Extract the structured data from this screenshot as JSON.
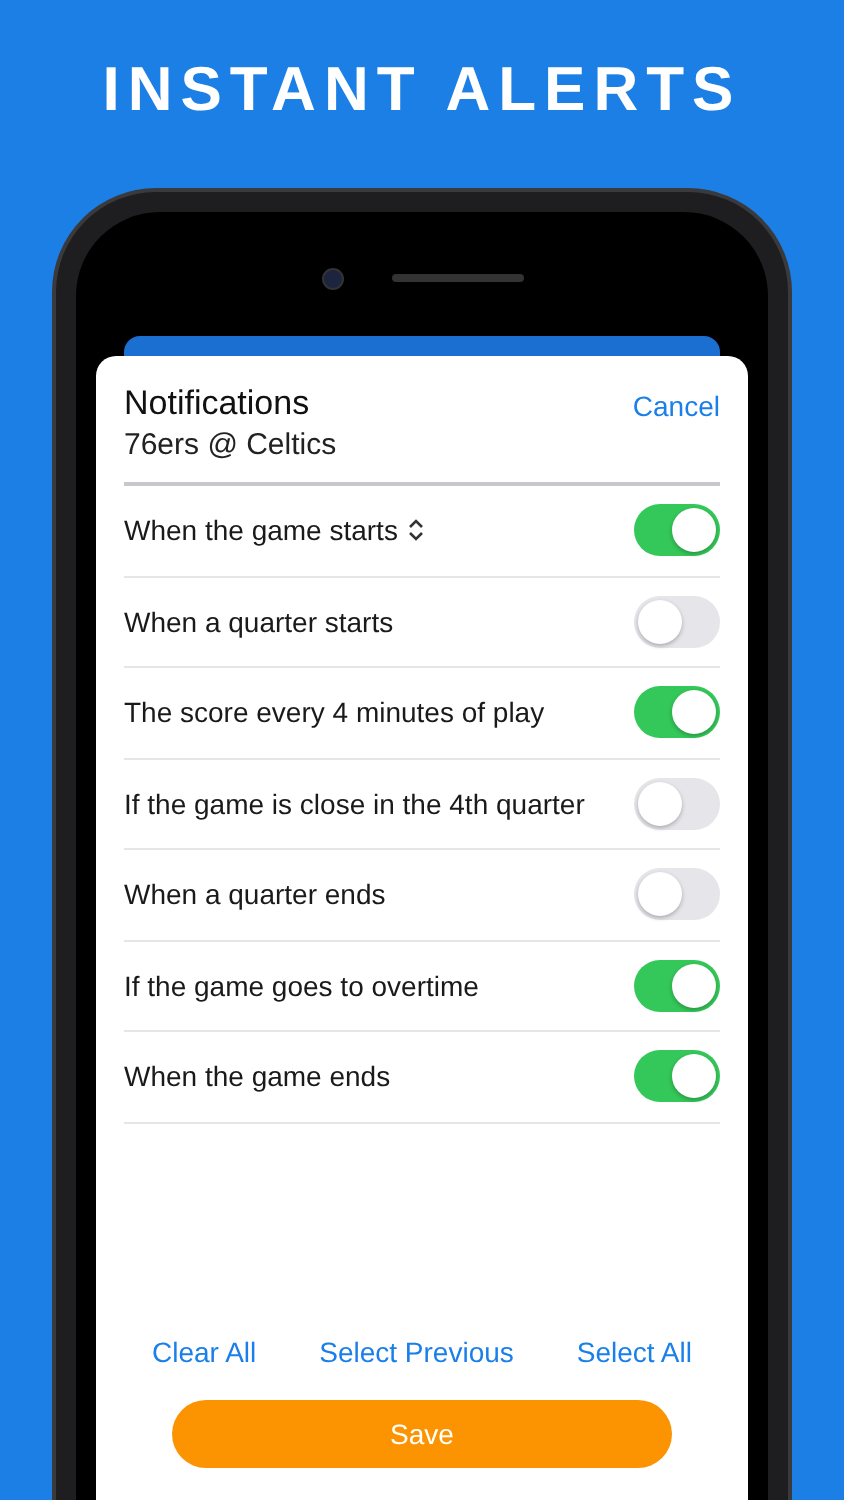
{
  "headline": "INSTANT ALERTS",
  "sheet": {
    "title": "Notifications",
    "subtitle": "76ers @ Celtics",
    "cancel": "Cancel"
  },
  "settings": [
    {
      "label": "When the game starts",
      "kind": "picker",
      "on": true
    },
    {
      "label": "When a quarter starts",
      "kind": "plain",
      "on": false
    },
    {
      "label": "The score every 4 minutes of play",
      "kind": "plain",
      "on": true
    },
    {
      "label": "If the game is close in the 4th quarter",
      "kind": "plain",
      "on": false
    },
    {
      "label": "When a quarter ends",
      "kind": "plain",
      "on": false
    },
    {
      "label": "If the game goes to overtime",
      "kind": "plain",
      "on": true
    },
    {
      "label": "When the game ends",
      "kind": "plain",
      "on": true
    }
  ],
  "links": [
    "Clear All",
    "Select Previous",
    "Select All"
  ],
  "save": "Save"
}
